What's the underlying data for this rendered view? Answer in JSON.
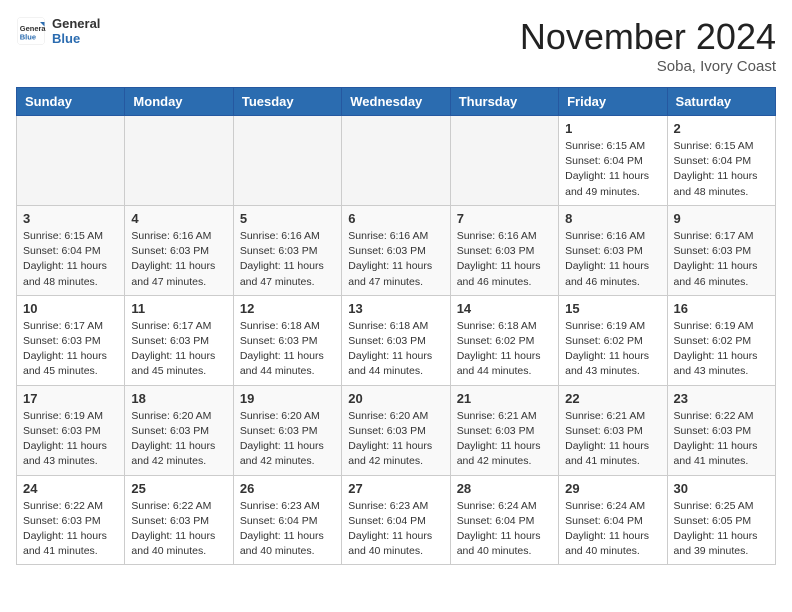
{
  "header": {
    "logo_general": "General",
    "logo_blue": "Blue",
    "month_title": "November 2024",
    "location": "Soba, Ivory Coast"
  },
  "days_of_week": [
    "Sunday",
    "Monday",
    "Tuesday",
    "Wednesday",
    "Thursday",
    "Friday",
    "Saturday"
  ],
  "weeks": [
    [
      {
        "day": "",
        "info": ""
      },
      {
        "day": "",
        "info": ""
      },
      {
        "day": "",
        "info": ""
      },
      {
        "day": "",
        "info": ""
      },
      {
        "day": "",
        "info": ""
      },
      {
        "day": "1",
        "info": "Sunrise: 6:15 AM\nSunset: 6:04 PM\nDaylight: 11 hours\nand 49 minutes."
      },
      {
        "day": "2",
        "info": "Sunrise: 6:15 AM\nSunset: 6:04 PM\nDaylight: 11 hours\nand 48 minutes."
      }
    ],
    [
      {
        "day": "3",
        "info": "Sunrise: 6:15 AM\nSunset: 6:04 PM\nDaylight: 11 hours\nand 48 minutes."
      },
      {
        "day": "4",
        "info": "Sunrise: 6:16 AM\nSunset: 6:03 PM\nDaylight: 11 hours\nand 47 minutes."
      },
      {
        "day": "5",
        "info": "Sunrise: 6:16 AM\nSunset: 6:03 PM\nDaylight: 11 hours\nand 47 minutes."
      },
      {
        "day": "6",
        "info": "Sunrise: 6:16 AM\nSunset: 6:03 PM\nDaylight: 11 hours\nand 47 minutes."
      },
      {
        "day": "7",
        "info": "Sunrise: 6:16 AM\nSunset: 6:03 PM\nDaylight: 11 hours\nand 46 minutes."
      },
      {
        "day": "8",
        "info": "Sunrise: 6:16 AM\nSunset: 6:03 PM\nDaylight: 11 hours\nand 46 minutes."
      },
      {
        "day": "9",
        "info": "Sunrise: 6:17 AM\nSunset: 6:03 PM\nDaylight: 11 hours\nand 46 minutes."
      }
    ],
    [
      {
        "day": "10",
        "info": "Sunrise: 6:17 AM\nSunset: 6:03 PM\nDaylight: 11 hours\nand 45 minutes."
      },
      {
        "day": "11",
        "info": "Sunrise: 6:17 AM\nSunset: 6:03 PM\nDaylight: 11 hours\nand 45 minutes."
      },
      {
        "day": "12",
        "info": "Sunrise: 6:18 AM\nSunset: 6:03 PM\nDaylight: 11 hours\nand 44 minutes."
      },
      {
        "day": "13",
        "info": "Sunrise: 6:18 AM\nSunset: 6:03 PM\nDaylight: 11 hours\nand 44 minutes."
      },
      {
        "day": "14",
        "info": "Sunrise: 6:18 AM\nSunset: 6:02 PM\nDaylight: 11 hours\nand 44 minutes."
      },
      {
        "day": "15",
        "info": "Sunrise: 6:19 AM\nSunset: 6:02 PM\nDaylight: 11 hours\nand 43 minutes."
      },
      {
        "day": "16",
        "info": "Sunrise: 6:19 AM\nSunset: 6:02 PM\nDaylight: 11 hours\nand 43 minutes."
      }
    ],
    [
      {
        "day": "17",
        "info": "Sunrise: 6:19 AM\nSunset: 6:03 PM\nDaylight: 11 hours\nand 43 minutes."
      },
      {
        "day": "18",
        "info": "Sunrise: 6:20 AM\nSunset: 6:03 PM\nDaylight: 11 hours\nand 42 minutes."
      },
      {
        "day": "19",
        "info": "Sunrise: 6:20 AM\nSunset: 6:03 PM\nDaylight: 11 hours\nand 42 minutes."
      },
      {
        "day": "20",
        "info": "Sunrise: 6:20 AM\nSunset: 6:03 PM\nDaylight: 11 hours\nand 42 minutes."
      },
      {
        "day": "21",
        "info": "Sunrise: 6:21 AM\nSunset: 6:03 PM\nDaylight: 11 hours\nand 42 minutes."
      },
      {
        "day": "22",
        "info": "Sunrise: 6:21 AM\nSunset: 6:03 PM\nDaylight: 11 hours\nand 41 minutes."
      },
      {
        "day": "23",
        "info": "Sunrise: 6:22 AM\nSunset: 6:03 PM\nDaylight: 11 hours\nand 41 minutes."
      }
    ],
    [
      {
        "day": "24",
        "info": "Sunrise: 6:22 AM\nSunset: 6:03 PM\nDaylight: 11 hours\nand 41 minutes."
      },
      {
        "day": "25",
        "info": "Sunrise: 6:22 AM\nSunset: 6:03 PM\nDaylight: 11 hours\nand 40 minutes."
      },
      {
        "day": "26",
        "info": "Sunrise: 6:23 AM\nSunset: 6:04 PM\nDaylight: 11 hours\nand 40 minutes."
      },
      {
        "day": "27",
        "info": "Sunrise: 6:23 AM\nSunset: 6:04 PM\nDaylight: 11 hours\nand 40 minutes."
      },
      {
        "day": "28",
        "info": "Sunrise: 6:24 AM\nSunset: 6:04 PM\nDaylight: 11 hours\nand 40 minutes."
      },
      {
        "day": "29",
        "info": "Sunrise: 6:24 AM\nSunset: 6:04 PM\nDaylight: 11 hours\nand 40 minutes."
      },
      {
        "day": "30",
        "info": "Sunrise: 6:25 AM\nSunset: 6:05 PM\nDaylight: 11 hours\nand 39 minutes."
      }
    ]
  ]
}
